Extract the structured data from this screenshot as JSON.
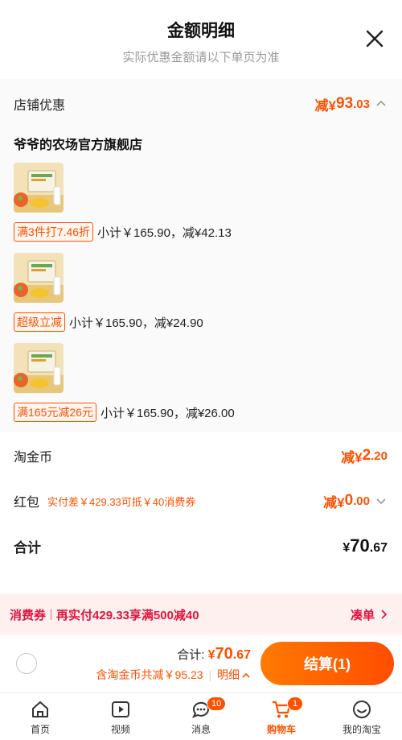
{
  "header": {
    "title": "金额明细",
    "subtitle": "实际优惠金额请以下单页为准"
  },
  "store_discount": {
    "label": "店铺优惠",
    "prefix": "减¥",
    "amount_int": "93",
    "amount_dec": ".03"
  },
  "store": {
    "name": "爷爷的农场官方旗舰店",
    "items": [
      {
        "tag": "满3件打7.46折",
        "line": "小计￥165.90，减¥42.13"
      },
      {
        "tag": "超级立减",
        "line": "小计￥165.90，减¥24.90"
      },
      {
        "tag": "满165元减26元",
        "line": "小计￥165.90，减¥26.00"
      }
    ]
  },
  "coin": {
    "label": "淘金币",
    "prefix": "减¥",
    "amount_int": "2",
    "amount_dec": ".20"
  },
  "red_packet": {
    "label": "红包",
    "note": "实付差￥429.33可抵￥40消费券",
    "prefix": "减¥",
    "amount_int": "0",
    "amount_dec": ".00"
  },
  "total": {
    "label": "合计",
    "prefix": "¥",
    "amount_int": "70",
    "amount_dec": ".67"
  },
  "coupon_bar": {
    "tag": "消费券",
    "text": "再实付429.33享满500减40",
    "action": "凑单"
  },
  "checkout": {
    "sum_label": "合计:",
    "currency": "¥",
    "amount_int": "70",
    "amount_dec": ".67",
    "saved_text": "含淘金币共减￥95.23",
    "detail_label": "明细",
    "pay_label": "结算(1)"
  },
  "tabbar": {
    "tabs": [
      {
        "label": "首页"
      },
      {
        "label": "视频"
      },
      {
        "label": "消息",
        "badge": "10"
      },
      {
        "label": "购物车",
        "badge": "1"
      },
      {
        "label": "我的淘宝"
      }
    ]
  },
  "colors": {
    "accent": "#ff5000",
    "coupon_red": "#e0143c"
  }
}
